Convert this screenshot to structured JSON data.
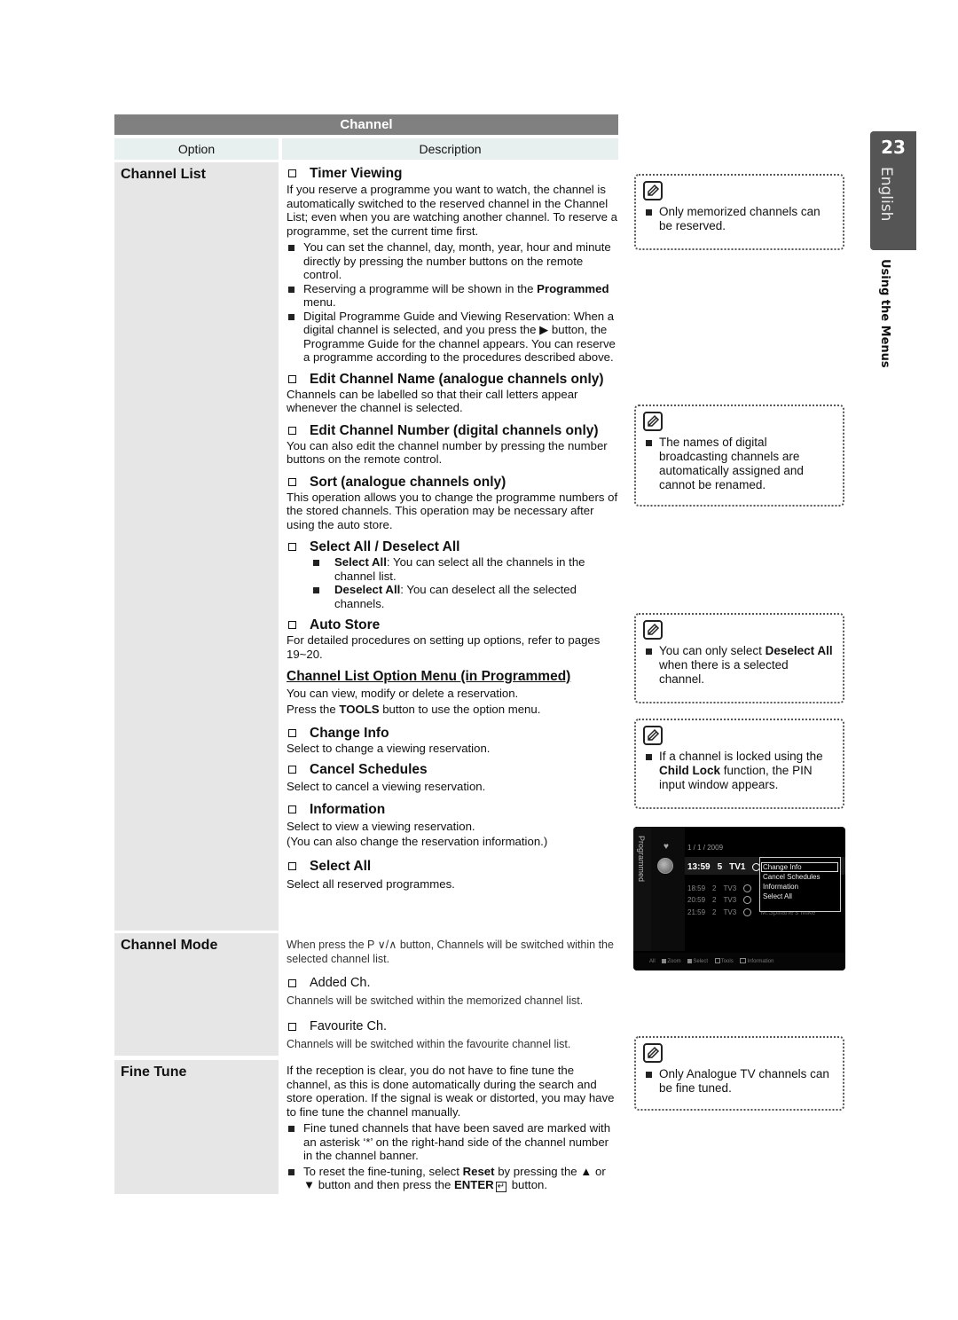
{
  "table": {
    "title": "Channel",
    "col_option": "Option",
    "col_description": "Description"
  },
  "channel_list": {
    "option": "Channel List",
    "timer_viewing": {
      "title": "Timer Viewing",
      "body": "If you reserve a programme you want to watch, the channel is automatically switched to the reserved channel in the Channel List; even when you are watching another channel. To reserve a programme, set the current time first.",
      "bullets": [
        "You can set the channel, day, month, year, hour and minute directly by pressing the number buttons on the remote control.",
        "Reserving a programme will be shown in the",
        "Digital Programme Guide and Viewing Reservation: When a digital channel is selected, and you press the ▶ button, the Programme Guide for the channel appears. You can reserve a programme according to the procedures described above."
      ],
      "bullet2_bold": "Programmed",
      "bullet2_tail": " menu."
    },
    "edit_name": {
      "title": "Edit Channel Name (analogue channels only)",
      "body": "Channels can be labelled so that their call letters appear whenever the channel is selected."
    },
    "edit_number": {
      "title": "Edit Channel Number (digital channels only)",
      "body": "You can also edit the channel number by pressing the number buttons on the remote control."
    },
    "sort": {
      "title": "Sort (analogue channels only)",
      "body": "This operation allows you to change the programme numbers of the stored channels. This operation may be necessary after using the auto store."
    },
    "select_deselect": {
      "title": "Select All / Deselect All",
      "b1_bold": "Select All",
      "b1_text": ": You can select all the channels in the channel list.",
      "b2_bold": "Deselect All",
      "b2_text": ": You can deselect all the selected channels."
    },
    "auto_store": {
      "title": "Auto Store",
      "body": "For detailed procedures on setting up options, refer to pages 19~20."
    },
    "option_menu": {
      "title": "Channel List Option Menu (in Programmed)",
      "line1": "You can view, modify or delete a reservation.",
      "line2_pre": "Press the ",
      "line2_bold": "TOOLS",
      "line2_post": " button to use the option menu."
    },
    "change_info": {
      "title": "Change Info",
      "body": "Select to change a viewing reservation."
    },
    "cancel_schedules": {
      "title": "Cancel Schedules",
      "body": "Select to cancel a viewing reservation."
    },
    "information": {
      "title": "Information",
      "body1": "Select to view a viewing reservation.",
      "body2": "(You can also change the reservation information.)"
    },
    "select_all": {
      "title": "Select All",
      "body": "Select all reserved programmes."
    }
  },
  "channel_mode": {
    "option": "Channel Mode",
    "body": "When press the P ∨/∧ button, Channels will be switched within the selected channel list.",
    "added": {
      "title": "Added Ch.",
      "body": "Channels will be switched within the memorized channel list."
    },
    "favourite": {
      "title": "Favourite Ch.",
      "body": "Channels will be switched within the favourite channel list."
    }
  },
  "fine_tune": {
    "option": "Fine Tune",
    "body": "If the reception is clear, you do not have to fine tune the channel, as this is done automatically during the search and store operation. If the signal is weak or distorted, you may have to fine tune the channel manually.",
    "b1": "Fine tuned channels that have been saved are marked with an asterisk ‘*’ on the right-hand side of the channel number in the channel banner.",
    "b2_pre": "To reset the fine-tuning, select ",
    "b2_bold1": "Reset",
    "b2_mid": " by pressing the ▲ or ▼ button and then press the ",
    "b2_bold2": "ENTER",
    "b2_icon": "↵",
    "b2_post": " button."
  },
  "notes": [
    {
      "text": "Only memorized channels can be reserved."
    },
    {
      "text": "The names of digital broadcasting channels are automatically assigned and cannot be renamed."
    },
    {
      "pre": "You can only select ",
      "bold": "Deselect All",
      "post": " when there is a selected channel."
    },
    {
      "pre": "If a channel is locked using the ",
      "bold": "Child Lock",
      "post": " function, the PIN input window appears."
    },
    {
      "text": "Only Analogue TV channels can be fine tuned."
    }
  ],
  "page_tab": {
    "number": "23",
    "language": "English",
    "section": "Using the Menus"
  },
  "tv_screen": {
    "side_label": "Programmed",
    "date": "1 / 1 / 2009",
    "main_row": {
      "time": "13:59",
      "ch": "5",
      "name": "TV1"
    },
    "rows": [
      {
        "time": "18:59",
        "ch": "2",
        "name": "TV3",
        "prog": ""
      },
      {
        "time": "20:59",
        "ch": "2",
        "name": "TV3",
        "prog": ""
      },
      {
        "time": "21:59",
        "ch": "2",
        "name": "TV3",
        "prog": "M.Spillane's Mike"
      }
    ],
    "menu": [
      "Change Info",
      "Cancel Schedules",
      "Information",
      "Select All"
    ],
    "footer": {
      "all": "All",
      "zoom": "Zoom",
      "select": "Select",
      "tools": "Tools",
      "info": "Information"
    }
  }
}
